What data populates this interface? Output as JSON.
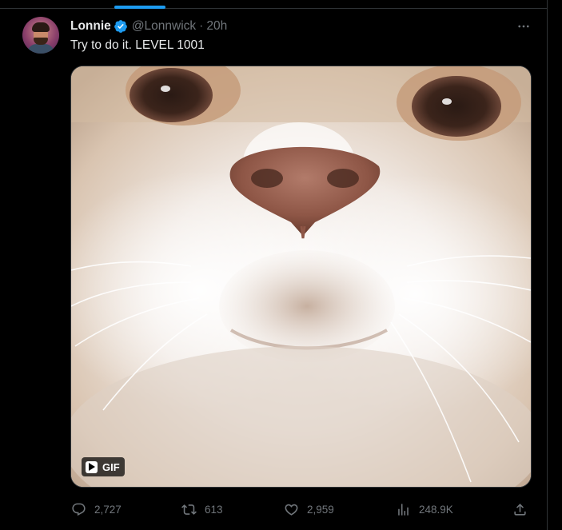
{
  "tweet": {
    "author_name": "Lonnie",
    "handle": "@Lonnwick",
    "separator": "·",
    "time": "20h",
    "text": "Try to do it. LEVEL 1001",
    "media_badge": "GIF",
    "actions": {
      "replies": "2,727",
      "reposts": "613",
      "likes": "2,959",
      "views": "248.9K"
    }
  },
  "icons": {
    "verified": "verified-badge-icon",
    "more": "more-horizontal-icon",
    "reply": "reply-icon",
    "repost": "repost-icon",
    "like": "heart-icon",
    "views": "analytics-icon",
    "share": "share-icon",
    "play": "play-icon"
  },
  "colors": {
    "accent": "#1d9bf0",
    "muted": "#71767b",
    "text": "#e7e9ea",
    "background": "#000000"
  }
}
